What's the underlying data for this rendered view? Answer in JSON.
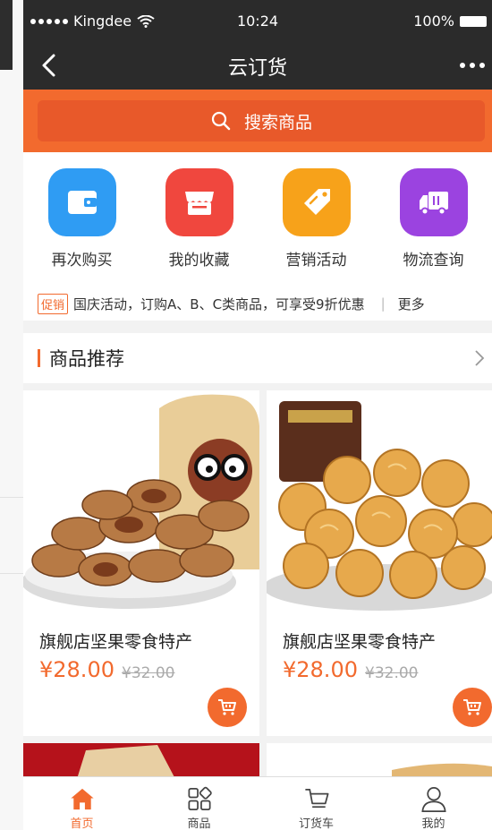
{
  "status_bar": {
    "carrier": "Kingdee",
    "time": "10:24",
    "battery": "100%"
  },
  "nav": {
    "title": "云订货",
    "back_icon": "chevron-left-icon",
    "more_icon": "more-dots-icon"
  },
  "search": {
    "placeholder": "搜索商品",
    "icon": "search-icon"
  },
  "quick_actions": [
    {
      "label": "再次购买",
      "icon": "wallet-icon",
      "color": "#2f9cf3"
    },
    {
      "label": "我的收藏",
      "icon": "store-icon",
      "color": "#f0473e"
    },
    {
      "label": "营销活动",
      "icon": "tag-icon",
      "color": "#f7a21a"
    },
    {
      "label": "物流查询",
      "icon": "truck-icon",
      "color": "#9b43e0"
    }
  ],
  "promo": {
    "tag": "促销",
    "text": "国庆活动，订购A、B、C类商品，可享受9折优惠",
    "more": "更多"
  },
  "section": {
    "title": "商品推荐"
  },
  "products": [
    {
      "name": "旗舰店坚果零食特产",
      "price": "¥28.00",
      "original_price": "¥32.00",
      "image": "pecans"
    },
    {
      "name": "旗舰店坚果零食特产",
      "price": "¥28.00",
      "original_price": "¥32.00",
      "image": "snack-balls"
    }
  ],
  "tabbar": [
    {
      "label": "首页",
      "icon": "home-icon",
      "active": true
    },
    {
      "label": "商品",
      "icon": "grid-icon",
      "active": false
    },
    {
      "label": "订货车",
      "icon": "cart-icon",
      "active": false
    },
    {
      "label": "我的",
      "icon": "user-icon",
      "active": false
    }
  ],
  "colors": {
    "brand": "#f26a2e",
    "nav_bg": "#2b2b2b",
    "page_bg": "#f2f2f2"
  }
}
